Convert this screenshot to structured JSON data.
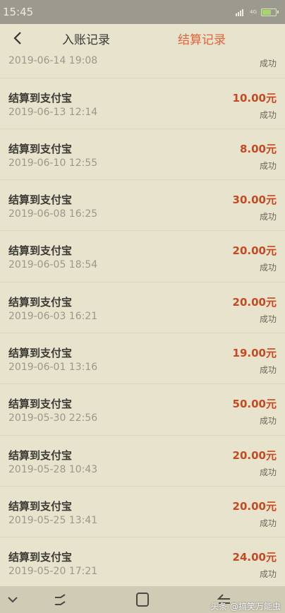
{
  "status_bar": {
    "time": "15:45",
    "network": "4G"
  },
  "header": {
    "tab_income": "入账记录",
    "tab_settle": "结算记录"
  },
  "partial_row": {
    "date": "2019-06-14 19:08",
    "status": "成功"
  },
  "records": [
    {
      "title": "结算到支付宝",
      "date": "2019-06-13 12:14",
      "amount": "10.00元",
      "status": "成功"
    },
    {
      "title": "结算到支付宝",
      "date": "2019-06-10 12:55",
      "amount": "8.00元",
      "status": "成功"
    },
    {
      "title": "结算到支付宝",
      "date": "2019-06-08 16:25",
      "amount": "30.00元",
      "status": "成功"
    },
    {
      "title": "结算到支付宝",
      "date": "2019-06-05 18:54",
      "amount": "20.00元",
      "status": "成功"
    },
    {
      "title": "结算到支付宝",
      "date": "2019-06-03 16:21",
      "amount": "20.00元",
      "status": "成功"
    },
    {
      "title": "结算到支付宝",
      "date": "2019-06-01 13:16",
      "amount": "19.00元",
      "status": "成功"
    },
    {
      "title": "结算到支付宝",
      "date": "2019-05-30 22:56",
      "amount": "50.00元",
      "status": "成功"
    },
    {
      "title": "结算到支付宝",
      "date": "2019-05-28 10:43",
      "amount": "20.00元",
      "status": "成功"
    },
    {
      "title": "结算到支付宝",
      "date": "2019-05-25 13:41",
      "amount": "20.00元",
      "status": "成功"
    },
    {
      "title": "结算到支付宝",
      "date": "2019-05-20 17:21",
      "amount": "24.00元",
      "status": "成功"
    }
  ],
  "watermark": "头条 @搞笑万能虫",
  "colors": {
    "accent": "#e0653a",
    "amount": "#c8481f",
    "background": "#e7e3cd"
  },
  "icons": {
    "back": "chevron-left-icon",
    "nav_down": "chevron-down-icon",
    "nav_recent": "recent-apps-icon",
    "nav_home": "home-square-icon",
    "nav_back": "back-arrow-icon"
  }
}
